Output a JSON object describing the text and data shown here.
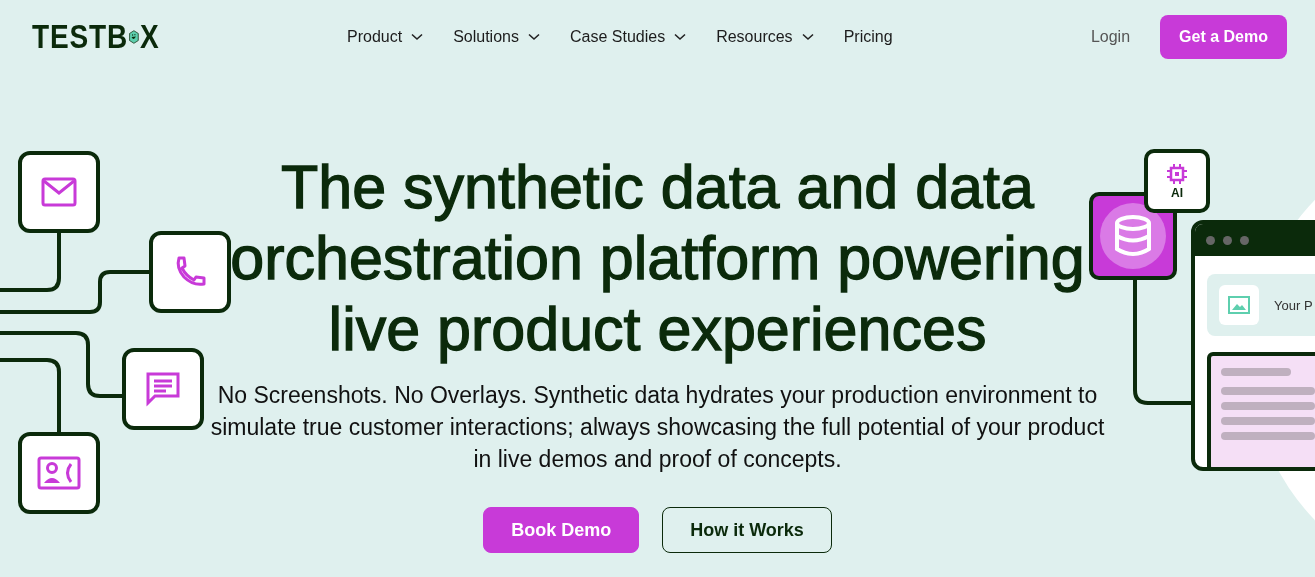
{
  "logo": {
    "text_before": "TESTB",
    "text_after": "X"
  },
  "nav": [
    {
      "label": "Product",
      "dropdown": true
    },
    {
      "label": "Solutions",
      "dropdown": true
    },
    {
      "label": "Case Studies",
      "dropdown": true
    },
    {
      "label": "Resources",
      "dropdown": true
    },
    {
      "label": "Pricing",
      "dropdown": false
    }
  ],
  "login": "Login",
  "demo_button": "Get a Demo",
  "hero": {
    "title": "The synthetic data and data orchestration platform powering live product experiences",
    "subtitle": "No Screenshots. No Overlays. Synthetic data hydrates your production environment to simulate true customer interactions; always showcasing the full potential of your product in live demos and proof of concepts.",
    "primary_button": "Book Demo",
    "secondary_button": "How it Works"
  },
  "illustration": {
    "ai_label": "AI",
    "product_label": "Your P"
  }
}
